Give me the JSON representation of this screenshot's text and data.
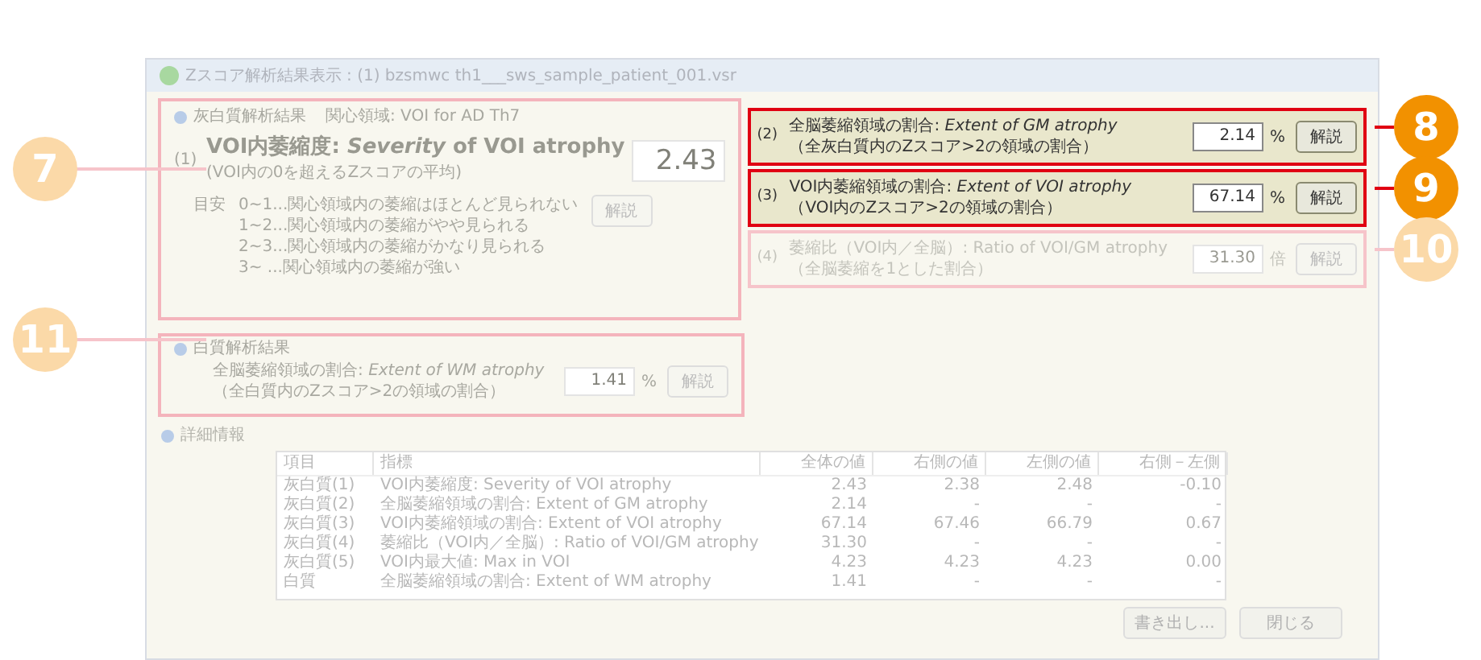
{
  "window": {
    "title": "Zスコア解析結果表示 : (1) bzsmwc th1___sws_sample_patient_001.vsr"
  },
  "gm_section": {
    "header": "灰白質解析結果",
    "roi": "関心領域: VOI for AD Th7",
    "index": "(1)",
    "title": "VOI内萎縮度: *Severity* of VOI atrophy",
    "subtitle": "(VOI内の0を超えるZスコアの平均)",
    "value": "2.43",
    "guide_label": "目安",
    "guide": [
      "0~1...関心領域内の萎縮はほとんど見られない",
      "1~2...関心領域内の萎縮がやや見られる",
      "2~3...関心領域内の萎縮がかなり見られる",
      "3~ ...関心領域内の萎縮が強い"
    ],
    "button": "解説"
  },
  "metrics": [
    {
      "index": "(2)",
      "label": "全脳萎縮領域の割合: *Extent of GM atrophy*",
      "sublabel": "（全灰白質内のZスコア>2の領域の割合）",
      "value": "2.14",
      "unit": "%",
      "button": "解説",
      "highlighted": true
    },
    {
      "index": "(3)",
      "label": "VOI内萎縮領域の割合: *Extent of VOI atrophy*",
      "sublabel": "（VOI内のZスコア>2の領域の割合）",
      "value": "67.14",
      "unit": "%",
      "button": "解説",
      "highlighted": true
    },
    {
      "index": "(4)",
      "label": "萎縮比（VOI内／全脳）: Ratio of VOI/GM atrophy",
      "sublabel": "（全脳萎縮を1とした割合）",
      "value": "31.30",
      "unit": "倍",
      "button": "解説",
      "highlighted": false
    }
  ],
  "wm_section": {
    "header": "白質解析結果",
    "label": "全脳萎縮領域の割合: *Extent of WM atrophy*",
    "sublabel": "（全白質内のZスコア>2の領域の割合）",
    "value": "1.41",
    "unit": "%",
    "button": "解説"
  },
  "details": {
    "header": "詳細情報",
    "columns": [
      "項目",
      "指標",
      "全体の値",
      "右側の値",
      "左側の値",
      "右側－左側"
    ],
    "rows": [
      [
        "灰白質(1)",
        "VOI内萎縮度: Severity of VOI atrophy",
        "2.43",
        "2.38",
        "2.48",
        "-0.10"
      ],
      [
        "灰白質(2)",
        "全脳萎縮領域の割合: Extent of GM atrophy",
        "2.14",
        "-",
        "-",
        "-"
      ],
      [
        "灰白質(3)",
        "VOI内萎縮領域の割合: Extent of VOI atrophy",
        "67.14",
        "67.46",
        "66.79",
        "0.67"
      ],
      [
        "灰白質(4)",
        "萎縮比（VOI内／全脳）: Ratio of VOI/GM atrophy",
        "31.30",
        "-",
        "-",
        "-"
      ],
      [
        "灰白質(5)",
        "VOI内最大値: Max in VOI",
        "4.23",
        "4.23",
        "4.23",
        "0.00"
      ],
      [
        "白質",
        "全脳萎縮領域の割合: Extent of WM atrophy",
        "1.41",
        "-",
        "-",
        "-"
      ]
    ]
  },
  "buttons": [
    "書き出し...",
    "閉じる"
  ],
  "callouts": [
    {
      "number": "7",
      "highlighted": false
    },
    {
      "number": "11",
      "highlighted": false
    },
    {
      "number": "8",
      "highlighted": true
    },
    {
      "number": "9",
      "highlighted": true
    },
    {
      "number": "10",
      "highlighted": false
    }
  ]
}
